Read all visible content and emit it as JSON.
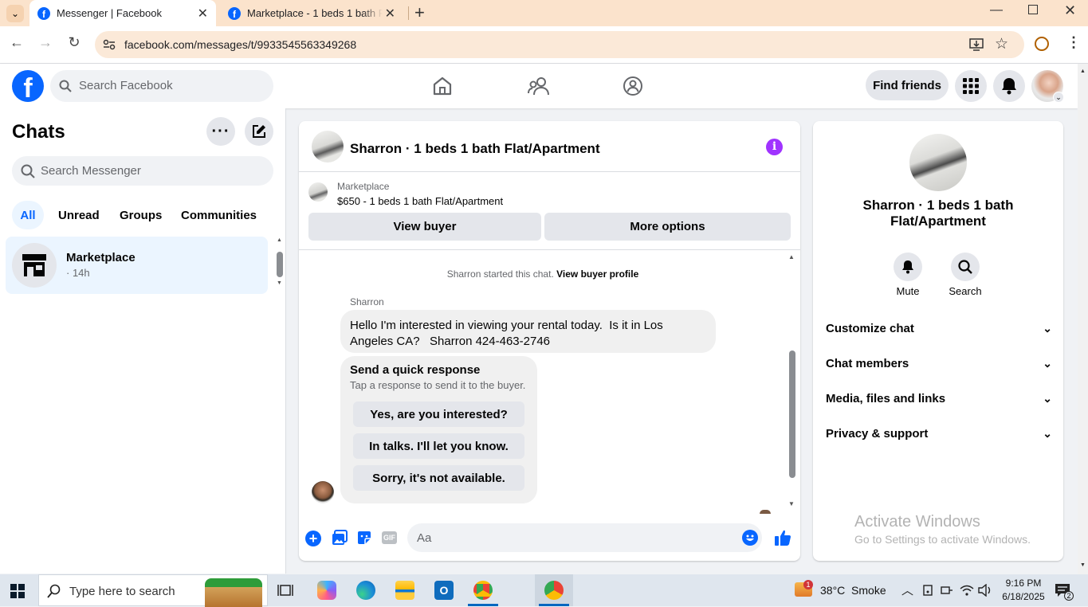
{
  "browser": {
    "tabs": [
      {
        "title": "Messenger | Facebook",
        "active": true
      },
      {
        "title": "Marketplace - 1 beds 1 bath Fla",
        "active": false
      }
    ],
    "url": "facebook.com/messages/t/9933545563349268"
  },
  "fb_header": {
    "search_placeholder": "Search Facebook",
    "find_friends_label": "Find friends"
  },
  "chats": {
    "title": "Chats",
    "search_placeholder": "Search Messenger",
    "filters": [
      "All",
      "Unread",
      "Groups",
      "Communities"
    ],
    "active_filter": "All",
    "conversations": [
      {
        "name": "Marketplace",
        "time": "· 14h"
      }
    ]
  },
  "conversation": {
    "title": "Sharron · 1 beds 1 bath Flat/Apartment",
    "listing_source": "Marketplace",
    "listing_summary": "$650 - 1 beds 1 bath Flat/Apartment",
    "view_buyer_label": "View buyer",
    "more_options_label": "More options",
    "system_text": "Sharron started this chat.",
    "system_link": "View buyer profile",
    "sender_name": "Sharron",
    "message_line1": "Hello I'm interested in viewing your rental today.  Is it in Los",
    "message_line2": "Angeles CA?   Sharron 424-463-2746",
    "quick_response_title": "Send a quick response",
    "quick_response_sub": "Tap a response to send it to the buyer.",
    "quick_responses": [
      "Yes, are you interested?",
      "In talks. I'll let you know.",
      "Sorry, it's not available."
    ],
    "composer_placeholder": "Aa"
  },
  "details": {
    "name_line1": "Sharron · 1 beds 1 bath",
    "name_line2": "Flat/Apartment",
    "mute_label": "Mute",
    "search_label": "Search",
    "sections": [
      "Customize chat",
      "Chat members",
      "Media, files and links",
      "Privacy & support"
    ],
    "watermark_title": "Activate Windows",
    "watermark_sub": "Go to Settings to activate Windows."
  },
  "taskbar": {
    "search_placeholder": "Type here to search",
    "weather": "38°C  Smoke",
    "weather_badge": "1",
    "time": "9:16 PM",
    "date": "6/18/2025",
    "notif_count": "2"
  },
  "colors": {
    "fb_blue": "#0866ff",
    "active_chat_bg": "#ebf5ff",
    "tabstrip": "#fbe3cc"
  }
}
